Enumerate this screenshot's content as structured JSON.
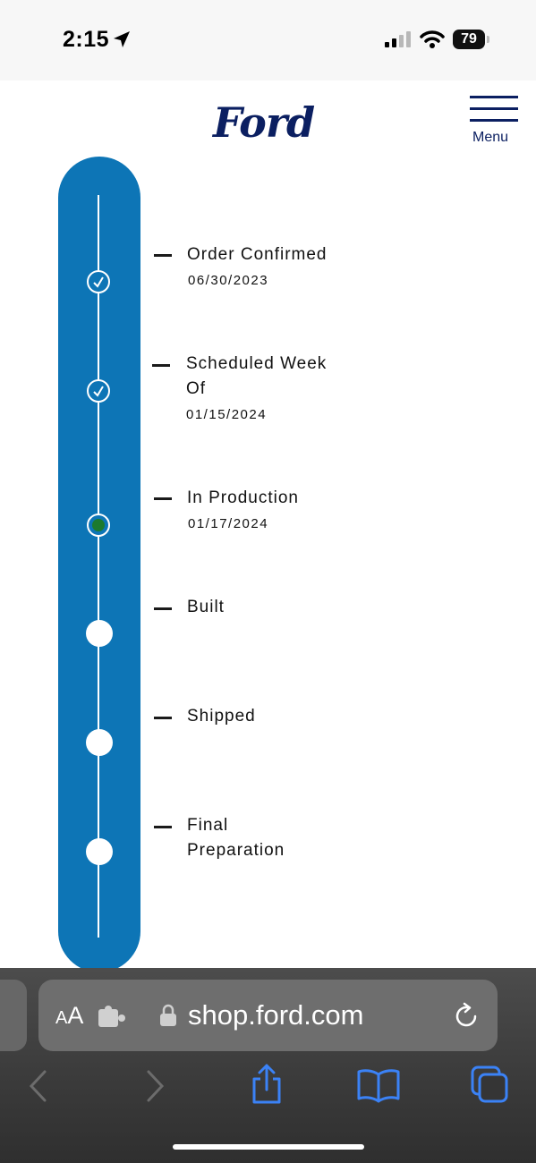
{
  "status_bar": {
    "time": "2:15",
    "battery": "79"
  },
  "header": {
    "logo_text": "Ford",
    "menu_label": "Menu"
  },
  "tracker": {
    "steps": [
      {
        "title_lines": [
          "Order Confirmed"
        ],
        "date": "06/30/2023",
        "state": "done"
      },
      {
        "title_lines": [
          "Scheduled Week",
          "Of"
        ],
        "date": "01/15/2024",
        "state": "done"
      },
      {
        "title_lines": [
          "In Production"
        ],
        "date": "01/17/2024",
        "state": "current"
      },
      {
        "title_lines": [
          "Built"
        ],
        "date": "",
        "state": "pending"
      },
      {
        "title_lines": [
          "Shipped"
        ],
        "date": "",
        "state": "pending"
      },
      {
        "title_lines": [
          "Final",
          "Preparation"
        ],
        "date": "",
        "state": "pending"
      }
    ]
  },
  "browser": {
    "aa_label_big": "A",
    "aa_label_small": "A",
    "url": "shop.ford.com"
  },
  "colors": {
    "track": "#0d75b6",
    "ford_navy": "#0b1f61",
    "current_dot": "#1c7a2d",
    "safari_blue": "#3b82f6"
  },
  "icons": {
    "location": "location-arrow-icon",
    "signal": "cellular-signal-icon",
    "wifi": "wifi-icon",
    "battery": "battery-icon",
    "menu": "hamburger-menu-icon",
    "extension": "extension-icon",
    "lock": "lock-icon",
    "reload": "reload-icon",
    "back": "chevron-left-icon",
    "forward": "chevron-right-icon",
    "share": "share-icon",
    "bookmarks": "book-icon",
    "tabs": "tabs-icon"
  }
}
